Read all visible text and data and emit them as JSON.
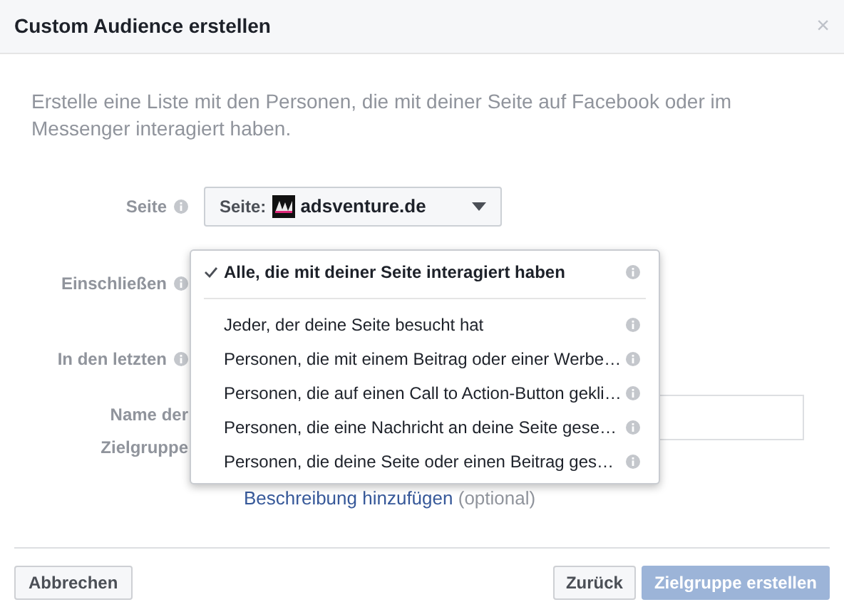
{
  "dialog": {
    "title": "Custom Audience erstellen",
    "close": "×"
  },
  "description": "Erstelle eine Liste mit den Personen, die mit deiner Seite auf Facebook oder im Messenger interagiert haben.",
  "fields": [
    {
      "label": "Seite"
    },
    {
      "label": "Einschließen"
    },
    {
      "label": "In den letzten"
    }
  ],
  "page_select": {
    "prefix": "Seite:",
    "value": "adsventure.de"
  },
  "name_field": {
    "label_lines": [
      "Name der",
      "Zielgruppe"
    ]
  },
  "description_link": {
    "link": "Beschreibung hinzufügen",
    "suffix": "(optional)"
  },
  "menu": {
    "items": [
      {
        "label": "Alle, die mit deiner Seite interagiert haben",
        "selected": true
      },
      {
        "label": "Jeder, der deine Seite besucht hat",
        "selected": false
      },
      {
        "label": "Personen, die mit einem Beitrag oder einer Werbe…",
        "selected": false
      },
      {
        "label": "Personen, die auf einen Call to Action-Button gekli…",
        "selected": false
      },
      {
        "label": "Personen, die eine Nachricht an deine Seite gese…",
        "selected": false
      },
      {
        "label": "Personen, die deine Seite oder einen Beitrag ges…",
        "selected": false
      }
    ]
  },
  "buttons": {
    "cancel": "Abbrechen",
    "back": "Zurück",
    "create": {
      "label": "Zielgruppe erstellen",
      "disabled": true
    }
  }
}
